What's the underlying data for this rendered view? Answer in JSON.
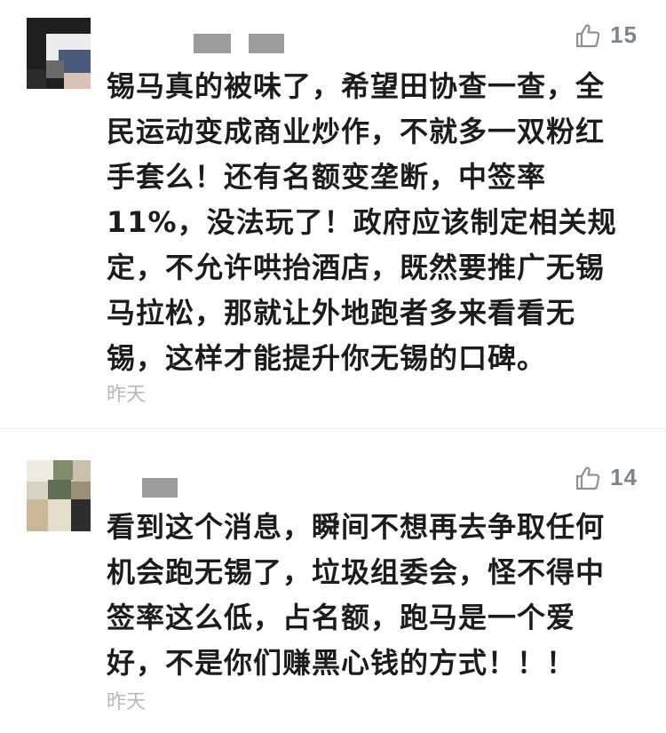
{
  "comments": [
    {
      "author": "",
      "likes": "15",
      "text": "锡马真的被味了，希望田协查一查，全\n民运动变成商业炒作，不就多一双粉红\n手套么！还有名额变垄断，中签率\n11%，没法玩了！政府应该制定相关规\n定，不允许哄抬酒店，既然要推广无锡\n马拉松，那就让外地跑者多来看看无\n锡，这样才能提升你无锡的口碑。",
      "time": "昨天"
    },
    {
      "author": "",
      "likes": "14",
      "text": "看到这个消息，瞬间不想再去争取任何\n机会跑无锡了，垃圾组委会，怪不得中\n签率这么低，占名额，跑马是一个爱\n好，不是你们赚黑心钱的方式！！！",
      "time": "昨天"
    }
  ],
  "icons": {
    "like": "thumbs-up-icon"
  },
  "colors": {
    "text": "#1c1c1c",
    "meta": "#b8b8b8",
    "like": "#7c848c"
  }
}
